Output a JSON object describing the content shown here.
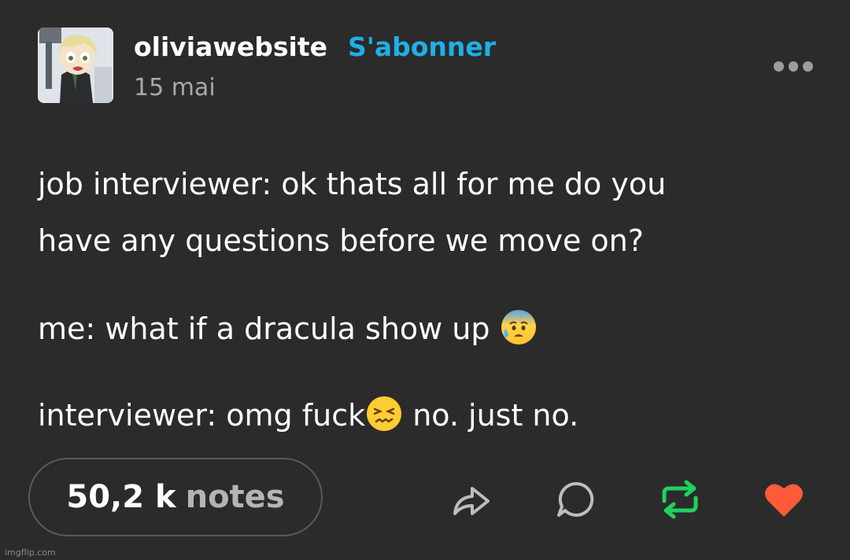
{
  "post": {
    "username": "oliviawebsite",
    "follow_label": "S'abonner",
    "date": "15 mai",
    "more_icon": "ellipsis-icon",
    "lines": {
      "l1": "job interviewer: ok thats all for me do you",
      "l2": "have any questions before we move on?",
      "l3": "me: what if a dracula show up",
      "l4a": "interviewer: omg fuck",
      "l4b": "no. just no."
    },
    "emojis": [
      "anxious-face-with-sweat-emoji",
      "confounded-face-emoji"
    ]
  },
  "footer": {
    "notes_count": "50,2 k",
    "notes_label": "notes",
    "icons": [
      "share-icon",
      "reply-icon",
      "reblog-icon",
      "like-icon"
    ],
    "colors": {
      "reblog": "#1fd25a",
      "like": "#ff5a3a",
      "follow": "#1eb0e8"
    }
  },
  "watermark": "imgflip.com"
}
